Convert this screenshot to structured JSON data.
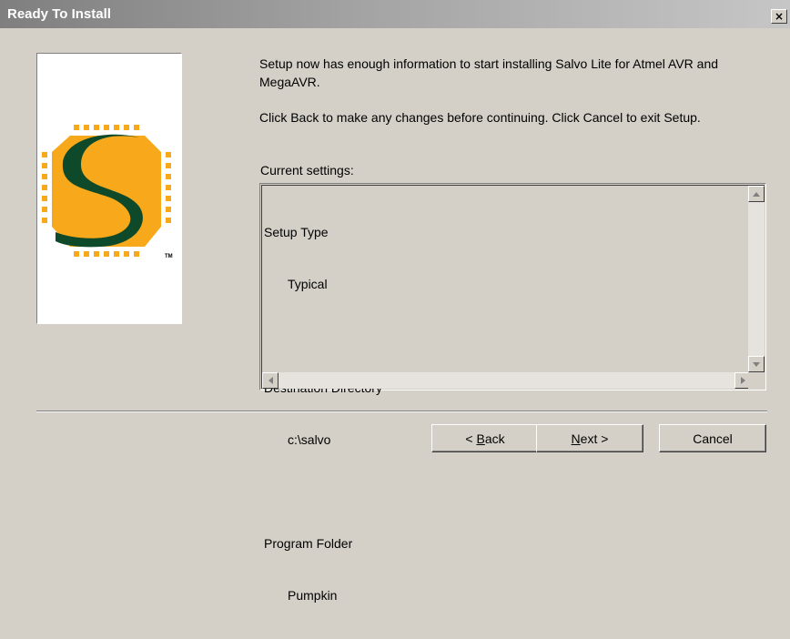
{
  "window": {
    "title": "Ready To Install",
    "close_glyph": "×"
  },
  "logo": {
    "icon": "salvo-s-chip-logo",
    "tm": "TM",
    "colors": {
      "chip": "#f7a81b",
      "s": "#0e4a2a"
    }
  },
  "intro": {
    "line1": "Setup now has enough information to start installing Salvo Lite for Atmel AVR and",
    "line2": "MegaAVR.",
    "line3": "Click Back to make any changes before continuing. Click Cancel to exit Setup."
  },
  "settings": {
    "label": "Current settings:",
    "entries": [
      {
        "heading": "Setup Type",
        "value": "Typical"
      },
      {
        "heading": "Destination Directory",
        "value": "c:\\salvo"
      },
      {
        "heading": "Program Folder",
        "value": "Pumpkin"
      }
    ]
  },
  "buttons": {
    "back": {
      "arrow": "<",
      "accel": "B",
      "rest": "ack"
    },
    "next": {
      "accel": "N",
      "rest": "ext",
      "arrow": ">"
    },
    "cancel": "Cancel"
  }
}
